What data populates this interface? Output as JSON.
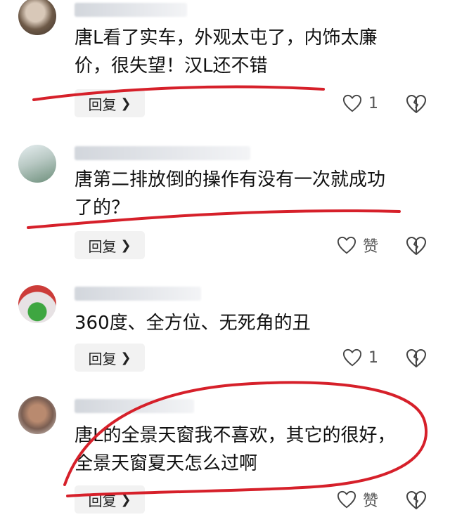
{
  "comments": [
    {
      "text_lines": [
        "唐L看了实车，外观太屯了，内饰太廉",
        "价，很失望！汉L还不错"
      ],
      "reply_label": "回复",
      "like_label": "1"
    },
    {
      "text_lines": [
        "唐第二排放倒的操作有没有一次就成功",
        "了的？"
      ],
      "reply_label": "回复",
      "like_label": "赞"
    },
    {
      "text_lines": [
        "360度、全方位、无死角的丑"
      ],
      "reply_label": "回复",
      "like_label": "1"
    },
    {
      "text_lines": [
        "唐L的全景天窗我不喜欢，其它的很好，",
        "全景天窗夏天怎么过啊"
      ],
      "reply_label": "回复",
      "like_label": "赞"
    }
  ],
  "colors": {
    "annotation": "#d6202a",
    "reply_bg": "#f2f2f2"
  },
  "icons": {
    "like": "heart-outline-icon",
    "dislike": "broken-heart-icon",
    "reply": "chevron-right-icon"
  }
}
